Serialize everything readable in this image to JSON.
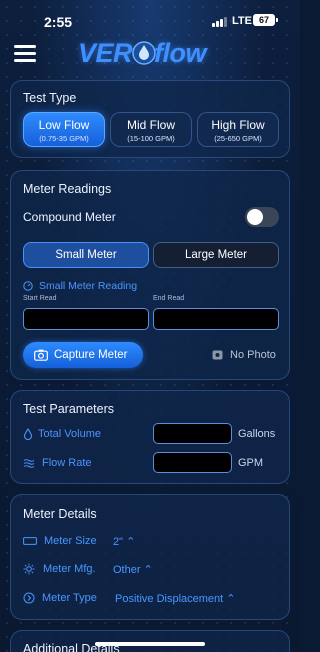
{
  "status_bar": {
    "time": "2:55",
    "network": "LTE",
    "battery": "67"
  },
  "header": {
    "logo_left": "VER",
    "logo_right": "flow",
    "menu_icon": "hamburger-menu-icon"
  },
  "test_type": {
    "title": "Test Type",
    "options": [
      {
        "label": "Low Flow",
        "range": "(0.75-35 GPM)",
        "selected": true
      },
      {
        "label": "Mid Flow",
        "range": "(15-100 GPM)",
        "selected": false
      },
      {
        "label": "High Flow",
        "range": "(25-650 GPM)",
        "selected": false
      }
    ]
  },
  "meter_readings": {
    "title": "Meter Readings",
    "compound_label": "Compound Meter",
    "compound_on": false,
    "small_meter": "Small Meter",
    "large_meter": "Large Meter",
    "section_label": "Small Meter Reading",
    "start_label": "Start Read",
    "end_label": "End Read",
    "start_value": "",
    "end_value": "",
    "capture_label": "Capture Meter",
    "no_photo": "No Photo"
  },
  "test_parameters": {
    "title": "Test Parameters",
    "volume_label": "Total Volume",
    "volume_unit": "Gallons",
    "volume_value": "",
    "rate_label": "Flow Rate",
    "rate_unit": "GPM",
    "rate_value": ""
  },
  "meter_details": {
    "title": "Meter Details",
    "size_label": "Meter Size",
    "size_value": "2\"",
    "mfg_label": "Meter Mfg.",
    "mfg_value": "Other",
    "type_label": "Meter Type",
    "type_value": "Positive Displacement"
  },
  "additional": {
    "title": "Additional Details"
  },
  "colors": {
    "accent": "#2f8bff",
    "link": "#4a96ff",
    "card_bg": "#10264a"
  }
}
